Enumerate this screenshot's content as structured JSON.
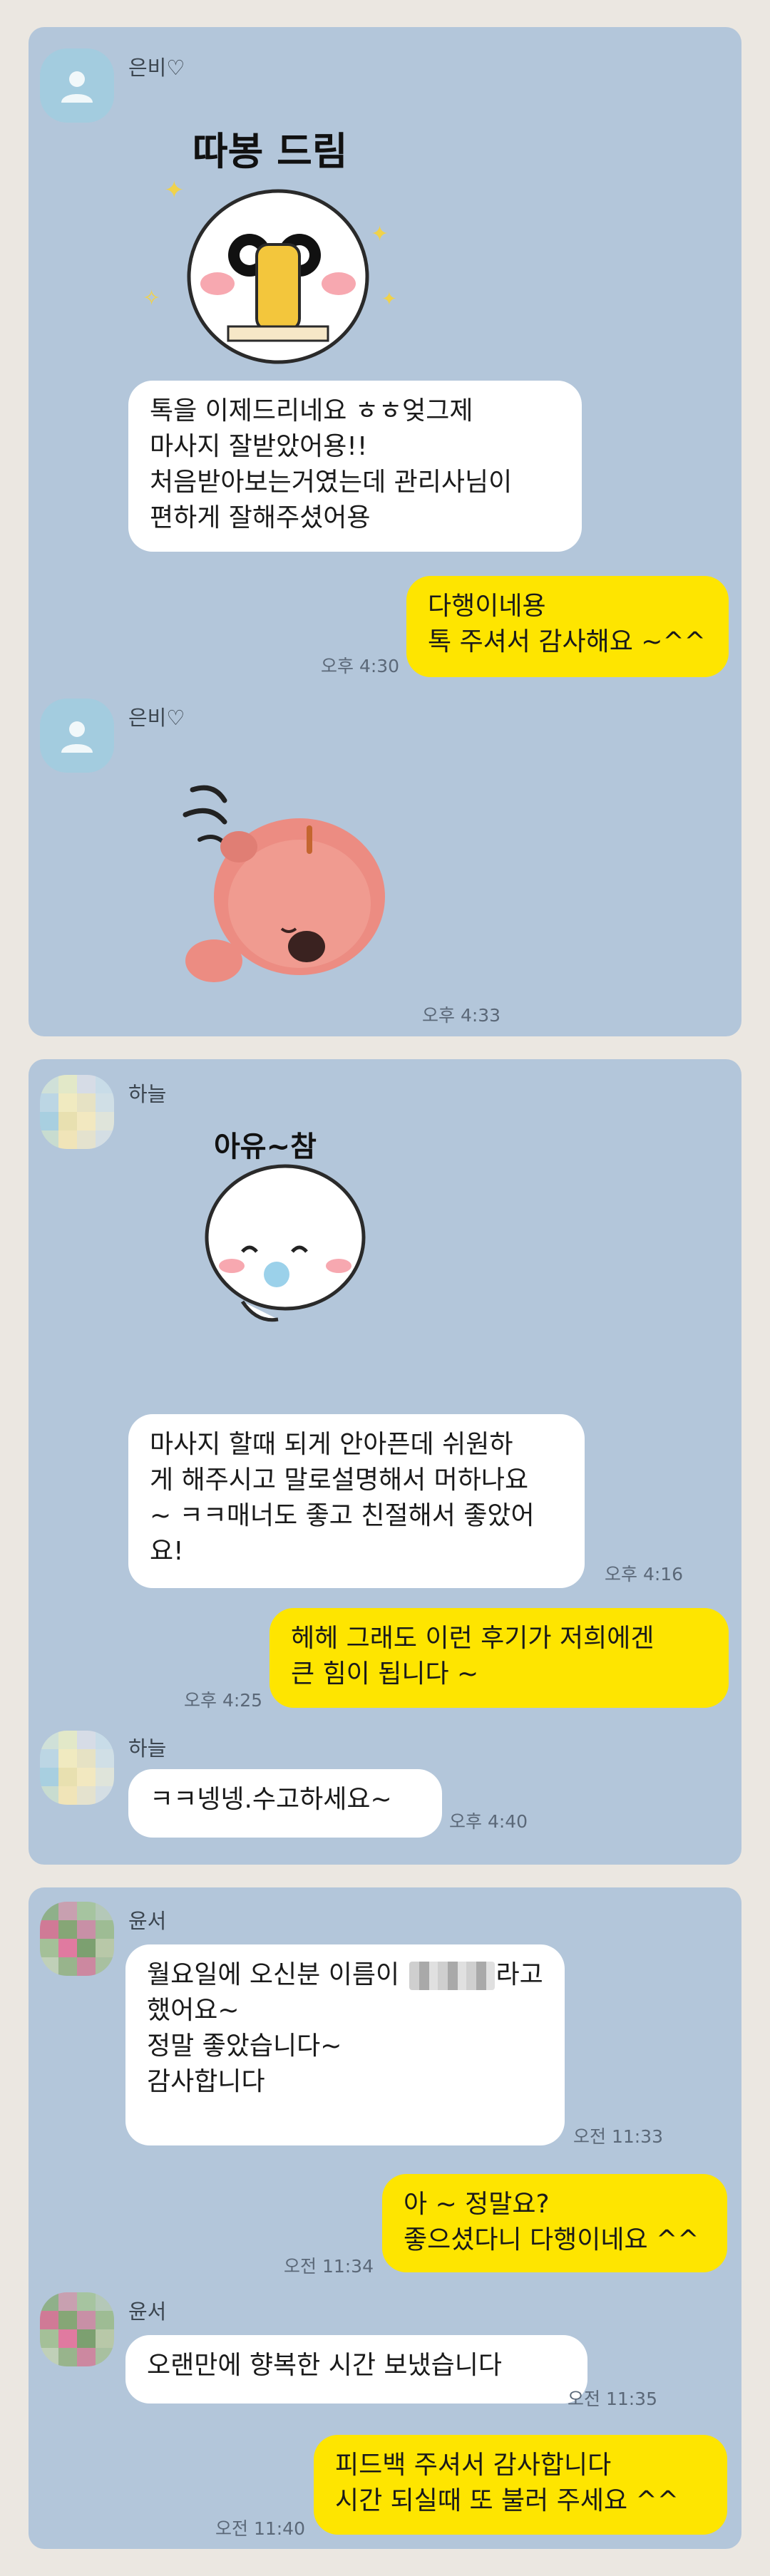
{
  "colors": {
    "background": "#ebe7e1",
    "chat_bg": "#b3c6da",
    "incoming_bubble": "#ffffff",
    "outgoing_bubble": "#fee500"
  },
  "chat1": {
    "sender": "은비♡",
    "sticker1_text": "따봉 드림",
    "msg1": "톡을 이제드리네요 ㅎㅎ엊그제\n마사지 잘받았어용!!\n처음받아보는거였는데 관리사님이\n편하게 잘해주셨어용",
    "reply1": "다행이네용\n톡 주셔서 감사해요 ~^^",
    "reply1_time": "오후 4:30",
    "sender2": "은비♡",
    "sticker2_time": "오후 4:33"
  },
  "chat2": {
    "sender": "하늘",
    "sticker_text": "아유~참",
    "msg1": "마사지 할때 되게 안아픈데 쉬원하\n게 해주시고 말로설명해서 머하나요\n~ ㅋㅋ매너도 좋고 친절해서 좋았어\n요!",
    "msg1_time": "오후 4:16",
    "reply1": "헤헤 그래도 이런 후기가 저희에겐\n큰 힘이 됩니다 ~",
    "reply1_time": "오후 4:25",
    "sender2": "하늘",
    "msg2": "ㅋㅋ넹넹.수고하세요~",
    "msg2_time": "오후 4:40"
  },
  "chat3": {
    "sender": "윤서",
    "msg1_part1": "월요일에 오신분 이름이",
    "msg1_part2": "라고",
    "msg1_rest": "했어요~\n정말 좋았습니다~\n감사합니다",
    "msg1_time": "오전 11:33",
    "reply1": "아 ~ 정말요?\n좋으셨다니 다행이네요 ^^",
    "reply1_time": "오전 11:34",
    "sender2": "윤서",
    "msg2": "오랜만에 향복한 시간 보냈습니다",
    "msg2_time": "오전 11:35",
    "reply2": "피드백 주셔서 감사합니다\n시간 되실때 또 불러 주세요 ^^",
    "reply2_time": "오전 11:40"
  },
  "icons": [
    "profile-silhouette-icon",
    "thumbs-up-sticker",
    "sad-pink-creature-sticker",
    "blushing-ghost-sticker",
    "blurred-avatar"
  ]
}
